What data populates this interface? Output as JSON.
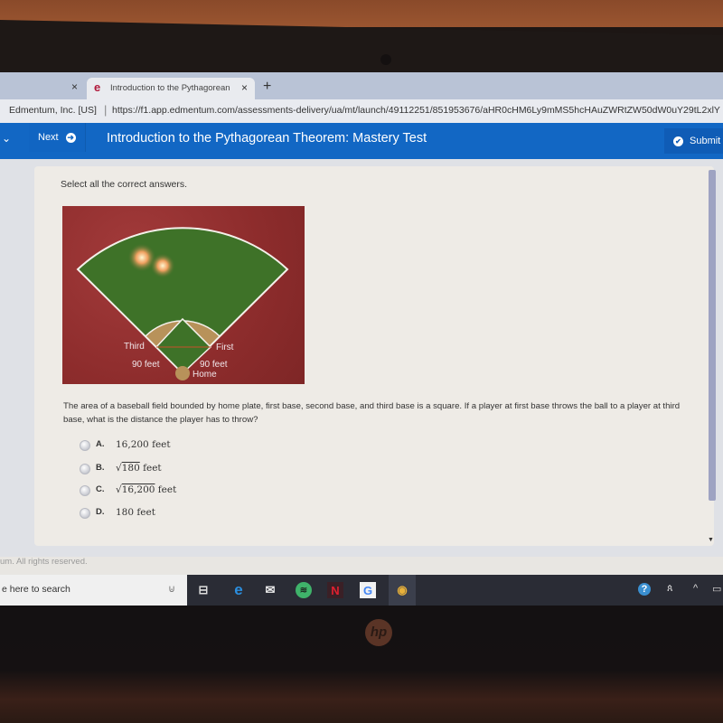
{
  "browser": {
    "tabs": [
      {
        "label": "",
        "close_icon": "×"
      },
      {
        "label": "Introduction to the Pythagorean",
        "favicon": "e",
        "close_icon": "×",
        "active": true
      }
    ],
    "new_tab_icon": "+",
    "site_identity": "Edmentum, Inc. [US]",
    "url": "https://f1.app.edmentum.com/assessments-delivery/ua/mt/launch/49112251/851953676/aHR0cHM6Ly9mMS5hcHAuZWRtZW50dW0uY29tL2xlY"
  },
  "appbar": {
    "menu_icon": "⌄",
    "next_label": "Next",
    "next_icon": "➜",
    "title": "Introduction to the Pythagorean Theorem: Mastery Test",
    "submit_label": "Submit T",
    "submit_icon": "✔",
    "color": "#1267c4"
  },
  "question": {
    "instruction": "Select all the correct answers.",
    "figure_labels": {
      "third": "Third",
      "first": "First",
      "left_side": "90 feet",
      "right_side": "90 feet",
      "home": "Home"
    },
    "prompt": "The area of a baseball field bounded by home plate, first base, second base, and third base is a square. If a player at first base throws the ball to a player at third base, what is the distance the player has to throw?",
    "options": [
      {
        "letter": "A.",
        "text": "16,200 feet",
        "radical": "",
        "selected": false
      },
      {
        "letter": "B.",
        "text": " feet",
        "radical": "180",
        "selected": false
      },
      {
        "letter": "C.",
        "text": " feet",
        "radical": "16,200",
        "selected": false
      },
      {
        "letter": "D.",
        "text": "180 feet",
        "radical": "",
        "selected": false
      }
    ]
  },
  "footer": {
    "copyright": "um. All rights reserved."
  },
  "taskbar": {
    "search_placeholder": "e here to search",
    "mic_icon": "🎙",
    "apps": [
      {
        "name": "task-view",
        "glyph": "⊟"
      },
      {
        "name": "edge",
        "glyph": "e"
      },
      {
        "name": "mail",
        "glyph": "✉"
      },
      {
        "name": "spotify",
        "glyph": "≋"
      },
      {
        "name": "netflix",
        "glyph": "N"
      },
      {
        "name": "google",
        "glyph": "G"
      },
      {
        "name": "chrome",
        "glyph": "◉"
      }
    ],
    "tray": {
      "help": "?",
      "people": "ጰ",
      "chevron": "^",
      "battery": "▭"
    }
  },
  "hardware": {
    "brand": "hp"
  }
}
